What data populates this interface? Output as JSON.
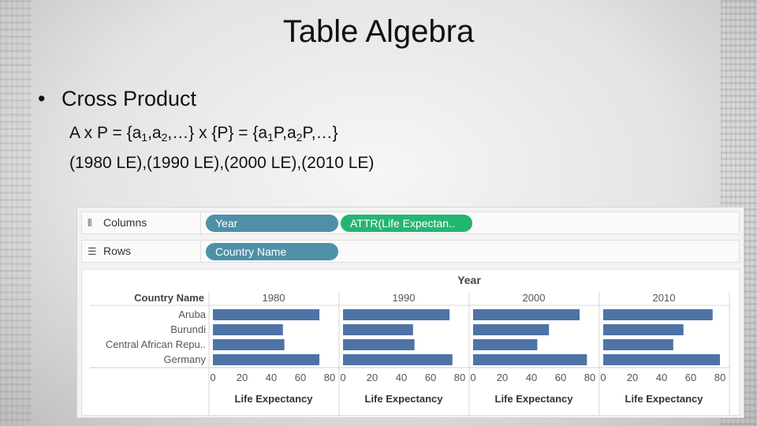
{
  "slide": {
    "title": "Table Algebra",
    "bullet": "Cross Product",
    "formula": {
      "p1": "A x P = {a",
      "s1": "1",
      "p2": ",a",
      "s2": "2",
      "p3": ",…} x {P} = {a",
      "s3": "1",
      "p4": "P,a",
      "s4": "2",
      "p5": "P,…}"
    },
    "le_line": "(1980 LE),(1990 LE),(2000 LE),(2010 LE)"
  },
  "shelves": {
    "columns": {
      "label": "Columns",
      "icon": "columns-icon",
      "pills": [
        "Year",
        "ATTR(Life Expectan.."
      ]
    },
    "rows": {
      "label": "Rows",
      "icon": "rows-icon",
      "pills": [
        "Country Name"
      ]
    }
  },
  "colors": {
    "bar": "#4e73a6",
    "pill_dimension": "#4e90a8",
    "pill_measure": "#24b573"
  },
  "chart_data": {
    "type": "bar",
    "column_header": "Year",
    "row_header": "Country Name",
    "years": [
      "1980",
      "1990",
      "2000",
      "2010"
    ],
    "categories": [
      "Aruba",
      "Burundi",
      "Central African Repu..",
      "Germany"
    ],
    "series": [
      {
        "name": "1980",
        "values": [
          73,
          48,
          49,
          73
        ]
      },
      {
        "name": "1990",
        "values": [
          73,
          48,
          49,
          75
        ]
      },
      {
        "name": "2000",
        "values": [
          73,
          52,
          44,
          78
        ]
      },
      {
        "name": "2010",
        "values": [
          75,
          55,
          48,
          80
        ]
      }
    ],
    "xlabel": "Life Expectancy",
    "xlim": [
      0,
      80
    ],
    "ticks": [
      "0",
      "20",
      "40",
      "60",
      "80"
    ]
  }
}
